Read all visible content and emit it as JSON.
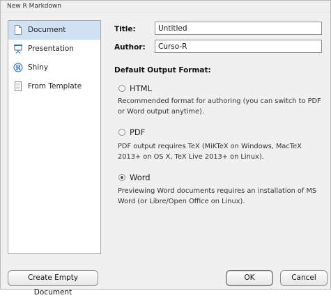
{
  "window": {
    "title": "New R Markdown"
  },
  "sidebar": {
    "items": [
      {
        "label": "Document",
        "icon": "document-icon",
        "selected": true
      },
      {
        "label": "Presentation",
        "icon": "presentation-icon",
        "selected": false
      },
      {
        "label": "Shiny",
        "icon": "shiny-r-icon",
        "selected": false
      },
      {
        "label": "From Template",
        "icon": "template-icon",
        "selected": false
      }
    ]
  },
  "form": {
    "title_label": "Title:",
    "title_value": "Untitled",
    "author_label": "Author:",
    "author_value": "Curso-R",
    "output_format_heading": "Default Output Format:",
    "options": [
      {
        "label": "HTML",
        "selected": false,
        "description_lines": [
          "Recommended format for authoring (you can switch to PDF",
          "or Word output anytime)."
        ]
      },
      {
        "label": "PDF",
        "selected": false,
        "description_lines": [
          "PDF output requires TeX (MiKTeX on Windows, MacTeX",
          "2013+ on OS X, TeX Live 2013+ on Linux)."
        ]
      },
      {
        "label": "Word",
        "selected": true,
        "description_lines": [
          "Previewing Word documents requires an installation of MS",
          "Word (or Libre/Open Office on Linux)."
        ]
      }
    ]
  },
  "buttons": {
    "create_empty": "Create Empty Document",
    "ok": "OK",
    "cancel": "Cancel"
  },
  "colors": {
    "selected_item_bg": "#cfe1f3",
    "dialog_bg": "#f0f0f0",
    "presentation_icon": "#2a6fb0",
    "shiny_icon": "#2f6db5"
  }
}
